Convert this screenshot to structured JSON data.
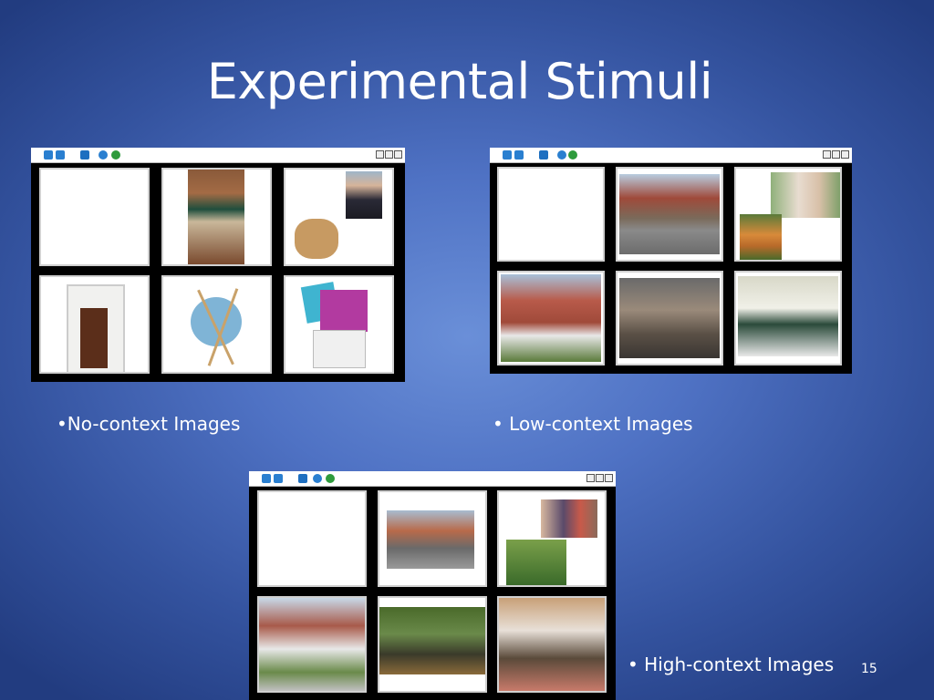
{
  "slide": {
    "title": "Experimental Stimuli",
    "page_number": "15"
  },
  "captions": {
    "no_context": "•No-context Images",
    "low_context": "• Low-context Images",
    "high_context": "• High-context Images"
  },
  "icons": [
    "home-icon",
    "forward-arrow-icon",
    "blank-icon",
    "stop-icon",
    "down-circle-icon",
    "green-go-icon"
  ],
  "colors": {
    "background": "#4f72c4",
    "text": "#ffffff",
    "window": "#000000"
  }
}
